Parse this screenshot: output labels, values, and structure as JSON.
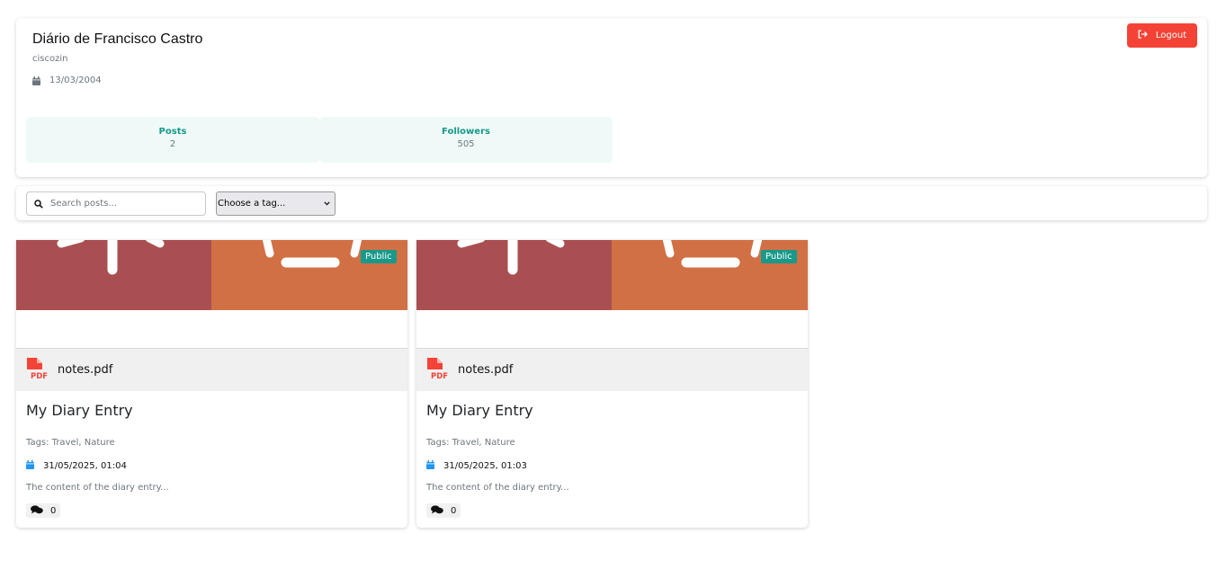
{
  "profile": {
    "title": "Diário de Francisco Castro",
    "username": "ciscozin",
    "birthdate": "13/03/2004",
    "logout_label": "Logout",
    "stats": [
      {
        "label": "Posts",
        "value": "2"
      },
      {
        "label": "Followers",
        "value": "505"
      }
    ]
  },
  "filters": {
    "search_placeholder": "Search posts...",
    "tag_select_value": "Choose a tag..."
  },
  "posts": [
    {
      "visibility": "Public",
      "attachment": "notes.pdf",
      "title": "My Diary Entry",
      "tags": "Tags: Travel, Nature",
      "date": "31/05/2025, 01:04",
      "excerpt": "The content of the diary entry...",
      "comment_count": "0"
    },
    {
      "visibility": "Public",
      "attachment": "notes.pdf",
      "title": "My Diary Entry",
      "tags": "Tags: Travel, Nature",
      "date": "31/05/2025, 01:03",
      "excerpt": "The content of the diary entry...",
      "comment_count": "0"
    }
  ],
  "colors": {
    "accent": "#18998a",
    "stat_background": "#effaf8",
    "logout": "#f44336",
    "cover_left": "#a94f51",
    "cover_right": "#d17045",
    "pdf_icon": "#f44336",
    "calendar_icon": "#2196f3"
  },
  "icons": {
    "logout": "sign-out-icon",
    "calendar": "calendar-icon",
    "search": "search-icon",
    "select": "chevron-down-icon",
    "attachment": "pdf-file-icon",
    "comments": "comments-icon"
  }
}
